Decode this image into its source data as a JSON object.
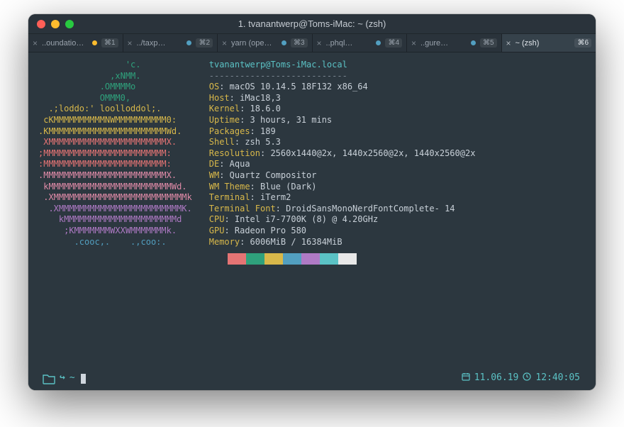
{
  "window": {
    "title": "1. tvanantwerp@Toms-iMac: ~ (zsh)"
  },
  "tabbar": {
    "tabs": [
      {
        "label": "..oundatio…",
        "dot_color": "#febc2e",
        "shortcut": "⌘1",
        "active": false
      },
      {
        "label": "../taxp…",
        "dot_color": "#529fc0",
        "shortcut": "⌘2",
        "active": false
      },
      {
        "label": "yarn (ope…",
        "dot_color": "#529fc0",
        "shortcut": "⌘3",
        "active": false
      },
      {
        "label": "..phql…",
        "dot_color": "#529fc0",
        "shortcut": "⌘4",
        "active": false
      },
      {
        "label": "..gure…",
        "dot_color": "#529fc0",
        "shortcut": "⌘5",
        "active": false
      },
      {
        "label": "~ (zsh)",
        "dot_color": "",
        "shortcut": "⌘6",
        "active": true
      }
    ]
  },
  "neofetch": {
    "host_line": "tvanantwerp@Toms-iMac.local",
    "separator": "---------------------------",
    "entries": [
      {
        "key": "OS",
        "value": "macOS 10.14.5 18F132 x86_64"
      },
      {
        "key": "Host",
        "value": "iMac18,3"
      },
      {
        "key": "Kernel",
        "value": "18.6.0"
      },
      {
        "key": "Uptime",
        "value": "3 hours, 31 mins"
      },
      {
        "key": "Packages",
        "value": "189"
      },
      {
        "key": "Shell",
        "value": "zsh 5.3"
      },
      {
        "key": "Resolution",
        "value": "2560x1440@2x, 1440x2560@2x, 1440x2560@2x"
      },
      {
        "key": "DE",
        "value": "Aqua"
      },
      {
        "key": "WM",
        "value": "Quartz Compositor"
      },
      {
        "key": "WM Theme",
        "value": "Blue (Dark)"
      },
      {
        "key": "Terminal",
        "value": "iTerm2"
      },
      {
        "key": "Terminal Font",
        "value": "DroidSansMonoNerdFontComplete- 14"
      },
      {
        "key": "CPU",
        "value": "Intel i7-7700K (8) @ 4.20GHz"
      },
      {
        "key": "GPU",
        "value": "Radeon Pro 580"
      },
      {
        "key": "Memory",
        "value": "6006MiB / 16384MiB"
      }
    ],
    "swatches": [
      "#2c373f",
      "#e57474",
      "#2fa17c",
      "#d8b84a",
      "#529fc0",
      "#af7ac5",
      "#5bc2c5",
      "#e8e8e8"
    ],
    "ascii_art": [
      "                 'c.",
      "              ,xNMM.",
      "            .OMMMMo",
      "            OMMM0,",
      "  .;loddo:' loolloddol;.",
      " cKMMMMMMMMMMNWMMMMMMMMMM0:",
      ".KMMMMMMMMMMMMMMMMMMMMMMMWd.",
      " XMMMMMMMMMMMMMMMMMMMMMMMX.",
      ";MMMMMMMMMMMMMMMMMMMMMMMM:",
      ":MMMMMMMMMMMMMMMMMMMMMMMM:",
      ".MMMMMMMMMMMMMMMMMMMMMMMMX.",
      " kMMMMMMMMMMMMMMMMMMMMMMMMWd.",
      " .XMMMMMMMMMMMMMMMMMMMMMMMMMMk",
      "  .XMMMMMMMMMMMMMMMMMMMMMMMMK.",
      "    kMMMMMMMMMMMMMMMMMMMMMMd",
      "     ;KMMMMMMMWXXWMMMMMMMk.",
      "       .cooc,.    .,coo:."
    ]
  },
  "statusbar": {
    "cwd": "~",
    "date": "11.06.19",
    "time": "12:40:05"
  }
}
